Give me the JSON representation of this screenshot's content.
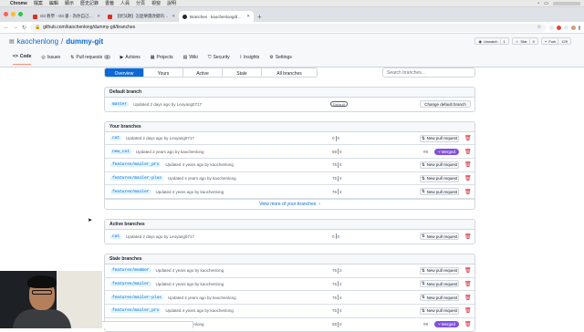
{
  "menubar": {
    "app": "Chrome",
    "items": [
      "檔案",
      "編輯",
      "顯示",
      "歷史記錄",
      "書籤",
      "人員",
      "分頁",
      "視窗",
      "說明"
    ]
  },
  "tabs": [
    {
      "title": "Git 教學 - Git 書 - 為你自己學...",
      "color": "#d93025"
    },
    {
      "title": "【狀況題】怎麼樂團改變的訂...",
      "color": "#d93025"
    },
    {
      "title": "Branches · kaochenlong/dummy-git",
      "color": "#24292f"
    }
  ],
  "address": {
    "url": "github.com/kaochenlong/dummy-git/branches"
  },
  "repo": {
    "owner": "kaochenlong",
    "name": "dummy-git",
    "watch": {
      "label": "Unwatch",
      "count": "1"
    },
    "star": {
      "label": "Star",
      "count": "0"
    },
    "fork": {
      "label": "Fork",
      "count": "129"
    }
  },
  "repo_tabs": [
    {
      "label": "Code",
      "icon": "code-icon"
    },
    {
      "label": "Issues",
      "icon": "issue-icon"
    },
    {
      "label": "Pull requests",
      "icon": "pr-icon",
      "count": "1"
    },
    {
      "label": "Actions",
      "icon": "actions-icon"
    },
    {
      "label": "Projects",
      "icon": "projects-icon"
    },
    {
      "label": "Wiki",
      "icon": "wiki-icon"
    },
    {
      "label": "Security",
      "icon": "shield-icon"
    },
    {
      "label": "Insights",
      "icon": "graph-icon"
    },
    {
      "label": "Settings",
      "icon": "gear-icon"
    }
  ],
  "branch_filters": [
    "Overview",
    "Yours",
    "Active",
    "Stale",
    "All branches"
  ],
  "search": {
    "placeholder": "Search branches..."
  },
  "default_section": {
    "title": "Default branch",
    "branch": {
      "name": "master",
      "updated": "Updated 2 days ago by Leoyang0717",
      "badge": "Default",
      "button": "Change default branch"
    }
  },
  "your_section": {
    "title": "Your branches",
    "branches": [
      {
        "name": "cat",
        "updated": "Updated 2 days ago by Leoyang0717",
        "behind": "0",
        "ahead": "0",
        "pr": "",
        "merged": "",
        "button": "New pull request"
      },
      {
        "name": "new_cat",
        "updated": "Updated 2 years ago by kaochenlong",
        "behind": "59",
        "ahead": "0",
        "pr": "#8",
        "merged": "Merged",
        "button": ""
      },
      {
        "name": "features/mailer_pro",
        "updated": "Updated 4 years ago by kaochenlong",
        "behind": "76",
        "ahead": "4",
        "pr": "",
        "merged": "",
        "button": "New pull request"
      },
      {
        "name": "features/mailer-plus",
        "updated": "Updated 4 years ago by kaochenlong",
        "behind": "76",
        "ahead": "4",
        "pr": "",
        "merged": "",
        "button": "New pull request"
      },
      {
        "name": "features/mailer",
        "updated": "Updated 4 years ago by kaochenlong",
        "behind": "76",
        "ahead": "4",
        "pr": "",
        "merged": "",
        "button": "New pull request"
      }
    ],
    "view_more": "View more of your branches"
  },
  "active_section": {
    "title": "Active branches",
    "branches": [
      {
        "name": "cat",
        "updated": "Updated 2 days ago by Leoyang0717",
        "behind": "0",
        "ahead": "0",
        "button": "New pull request"
      }
    ]
  },
  "stale_section": {
    "title": "Stale branches",
    "branches": [
      {
        "name": "features/member",
        "updated": "Updated 4 years ago by kaochenlong",
        "behind": "76",
        "ahead": "2",
        "pr": "",
        "merged": "",
        "button": "New pull request"
      },
      {
        "name": "features/mailer",
        "updated": "Updated 4 years ago by kaochenlong",
        "behind": "76",
        "ahead": "4",
        "pr": "",
        "merged": "",
        "button": "New pull request"
      },
      {
        "name": "features/mailer-plus",
        "updated": "Updated 4 years ago by kaochenlong",
        "behind": "76",
        "ahead": "4",
        "pr": "",
        "merged": "",
        "button": "New pull request"
      },
      {
        "name": "features/mailer_pro",
        "updated": "Updated 4 years ago by kaochenlong",
        "behind": "76",
        "ahead": "4",
        "pr": "",
        "merged": "",
        "button": "New pull request"
      },
      {
        "name": "new_cat",
        "updated": "Updated 2 years ago by kaochenlong",
        "behind": "59",
        "ahead": "0",
        "pr": "#8",
        "merged": "Merged",
        "button": ""
      }
    ]
  },
  "colors": {
    "accent": "#0969da",
    "merged": "#8250df",
    "danger": "#cf222e"
  }
}
